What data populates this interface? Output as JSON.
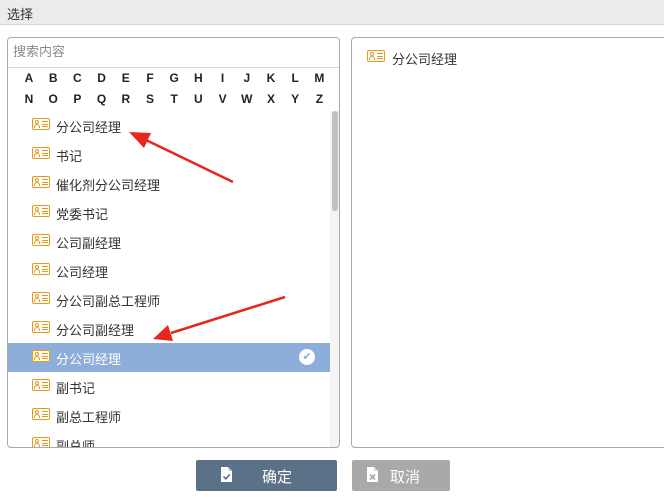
{
  "window": {
    "title": "选择"
  },
  "search": {
    "placeholder": "搜索内容"
  },
  "alphabet": {
    "row1": [
      "A",
      "B",
      "C",
      "D",
      "E",
      "F",
      "G",
      "H",
      "I",
      "J",
      "K",
      "L",
      "M"
    ],
    "row2": [
      "N",
      "O",
      "P",
      "Q",
      "R",
      "S",
      "T",
      "U",
      "V",
      "W",
      "X",
      "Y",
      "Z"
    ]
  },
  "options": [
    {
      "label": "分公司经理",
      "selected": false
    },
    {
      "label": "书记",
      "selected": false
    },
    {
      "label": "催化剂分公司经理",
      "selected": false
    },
    {
      "label": "党委书记",
      "selected": false
    },
    {
      "label": "公司副经理",
      "selected": false
    },
    {
      "label": "公司经理",
      "selected": false
    },
    {
      "label": "分公司副总工程师",
      "selected": false
    },
    {
      "label": "分公司副经理",
      "selected": false
    },
    {
      "label": "分公司经理",
      "selected": true
    },
    {
      "label": "副书记",
      "selected": false
    },
    {
      "label": "副总工程师",
      "selected": false
    },
    {
      "label": "副总师",
      "selected": false
    }
  ],
  "selected_items": [
    {
      "label": "分公司经理"
    }
  ],
  "buttons": {
    "confirm": "确定",
    "cancel": "取消"
  },
  "colors": {
    "selected_row": "#8daed8",
    "icon_orange": "#e59a1c",
    "confirm_button": "#5a7187",
    "cancel_button": "#a9a9a9",
    "annotation_arrow": "#e8261e"
  }
}
